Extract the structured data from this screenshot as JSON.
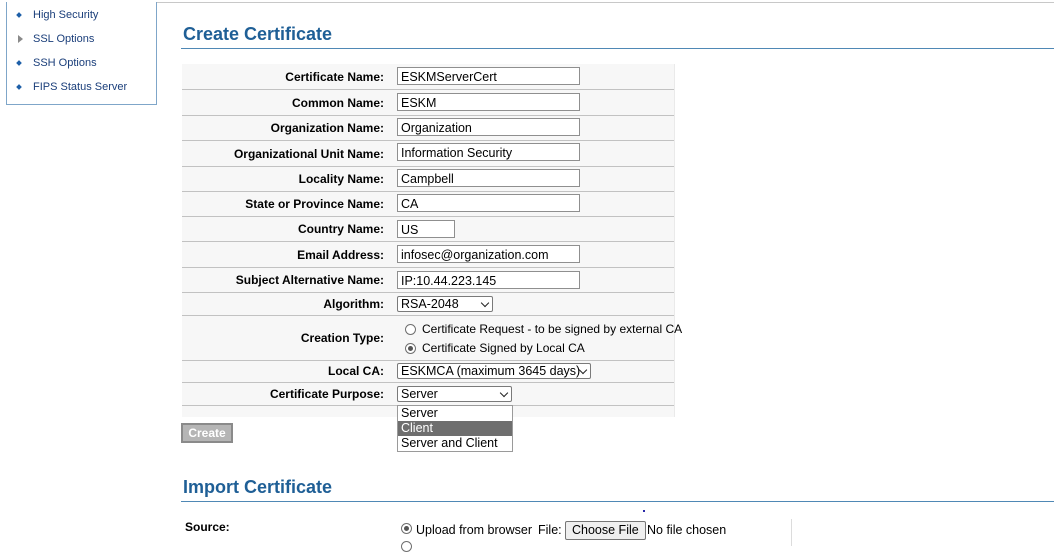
{
  "sidebar": {
    "items": [
      {
        "label": "High Security",
        "icon": "diamond-bullet-icon"
      },
      {
        "label": "SSL Options",
        "icon": "triangle-expand-icon"
      },
      {
        "label": "SSH Options",
        "icon": "diamond-bullet-icon"
      },
      {
        "label": "FIPS Status Server",
        "icon": "diamond-bullet-icon"
      }
    ]
  },
  "create": {
    "title": "Create Certificate",
    "fields": {
      "certificate_name": {
        "label": "Certificate Name:",
        "value": "ESKMServerCert"
      },
      "common_name": {
        "label": "Common Name:",
        "value": "ESKM"
      },
      "organization_name": {
        "label": "Organization Name:",
        "value": "Organization"
      },
      "org_unit_name": {
        "label": "Organizational Unit Name:",
        "value": "Information Security"
      },
      "locality_name": {
        "label": "Locality Name:",
        "value": "Campbell"
      },
      "state_name": {
        "label": "State or Province Name:",
        "value": "CA"
      },
      "country_name": {
        "label": "Country Name:",
        "value": "US"
      },
      "email_address": {
        "label": "Email Address:",
        "value": "infosec@organization.com"
      },
      "subject_alt_name": {
        "label": "Subject Alternative Name:",
        "value": "IP:10.44.223.145"
      }
    },
    "algorithm": {
      "label": "Algorithm:",
      "value": "RSA-2048"
    },
    "creation_type": {
      "label": "Creation Type:",
      "options": [
        "Certificate Request - to be signed by external CA",
        "Certificate Signed by Local CA"
      ],
      "selected": "Certificate Signed by Local CA"
    },
    "local_ca": {
      "label": "Local CA:",
      "value": "ESKMCA (maximum 3645 days)"
    },
    "purpose": {
      "label": "Certificate Purpose:",
      "value": "Server",
      "options": [
        "Server",
        "Client",
        "Server and Client"
      ],
      "highlighted": "Client"
    },
    "create_button": "Create"
  },
  "import": {
    "title": "Import Certificate",
    "source_label": "Source:",
    "source_option": "Upload from browser",
    "source_selected": true,
    "file_label": "File:",
    "choose_file_button": "Choose File",
    "no_file_text": "No file chosen"
  }
}
